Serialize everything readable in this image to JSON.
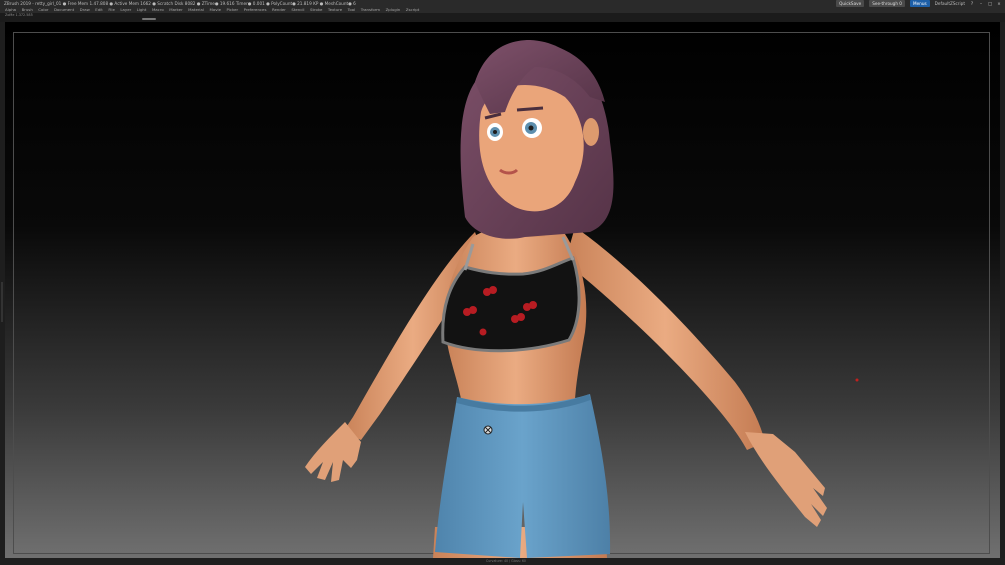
{
  "titlebar": {
    "app": "ZBrush 2019 - retty_girl_01",
    "stats": "● Free Mem 1.47.808 ● Active Mem 1662 ● Scratch Disk 8082 ● ZTime● 19.616 Timer● 0.001 ● PolyCount● 21.819 KP ● MeshCount● 6",
    "quicksave": "QuickSave",
    "see_through": "See-through 0",
    "menus_label": "Menus",
    "ui_layout": "DefaultZScript"
  },
  "menubar": {
    "items": [
      "Alpha",
      "Brush",
      "Color",
      "Document",
      "Draw",
      "Edit",
      "File",
      "Layer",
      "Light",
      "Macro",
      "Marker",
      "Material",
      "Movie",
      "Picker",
      "Preferences",
      "Render",
      "Stencil",
      "Stroke",
      "Texture",
      "Tool",
      "Transform",
      "Zplugin",
      "Zscript"
    ]
  },
  "status_text": "ZoMe 1.372.585",
  "footer_text": "Curvature: 40 / Gloss: 60",
  "colors": {
    "skin": "#e3a37a",
    "hair": "#6b4259",
    "shorts": "#5d94bd",
    "top": "#111111",
    "hearts": "#b71c22",
    "accent": "#1d5fa8"
  }
}
